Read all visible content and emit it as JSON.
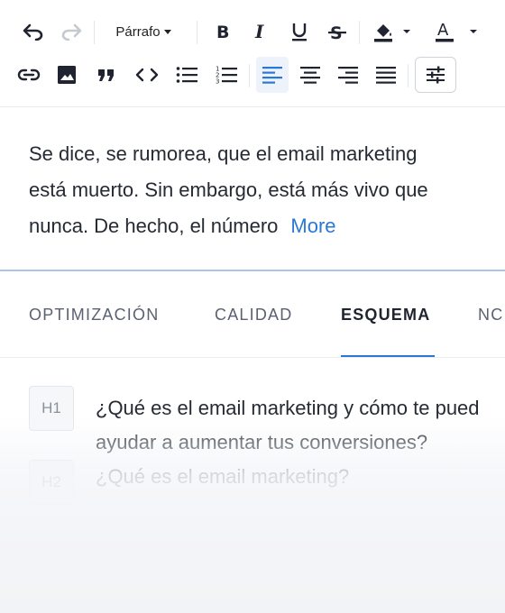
{
  "toolbar": {
    "paragraph_select": "Párrafo",
    "row1": [
      {
        "name": "undo-icon",
        "enabled": true
      },
      {
        "name": "redo-icon",
        "enabled": false
      },
      {
        "name": "bold-icon"
      },
      {
        "name": "italic-icon"
      },
      {
        "name": "underline-icon"
      },
      {
        "name": "strikethrough-icon"
      },
      {
        "name": "highlight-color-icon"
      },
      {
        "name": "text-color-icon"
      }
    ],
    "row2": [
      {
        "name": "link-icon"
      },
      {
        "name": "image-icon"
      },
      {
        "name": "quote-icon"
      },
      {
        "name": "code-icon"
      },
      {
        "name": "bullet-list-icon"
      },
      {
        "name": "numbered-list-icon"
      },
      {
        "name": "align-left-icon",
        "active": true
      },
      {
        "name": "align-center-icon"
      },
      {
        "name": "align-right-icon"
      },
      {
        "name": "align-justify-icon"
      },
      {
        "name": "settings-sliders-icon"
      }
    ]
  },
  "editor": {
    "lines": [
      "Se dice, se rumorea, que el email marketing",
      "está muerto. Sin embargo, está más vivo que",
      "nunca. De hecho, el número"
    ],
    "more_label": "More"
  },
  "tabs": [
    {
      "label": "OPTIMIZACIÓN",
      "active": false
    },
    {
      "label": "CALIDAD",
      "active": false
    },
    {
      "label": "ESQUEMA",
      "active": true
    },
    {
      "label": "NC",
      "active": false
    }
  ],
  "outline": [
    {
      "level": "H1",
      "lines": [
        "¿Qué es el email marketing y cómo te pued",
        "ayudar a aumentar tus conversiones?"
      ]
    },
    {
      "level": "H2",
      "lines": [
        "¿Qué es el email marketing?"
      ]
    }
  ],
  "colors": {
    "accent": "#2a78d6",
    "active_bg": "#eef3fb",
    "text": "#262a33",
    "muted": "#5b6170"
  }
}
